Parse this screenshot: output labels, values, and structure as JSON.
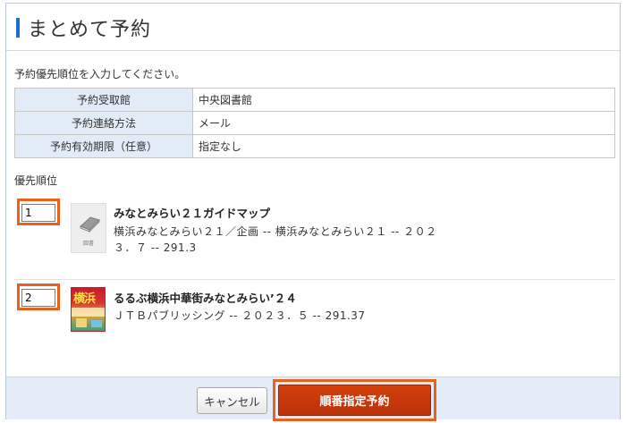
{
  "dialog": {
    "title": "まとめて予約"
  },
  "instruction": "予約優先順位を入力してください。",
  "settings": [
    {
      "label": "予約受取館",
      "value": "中央図書館"
    },
    {
      "label": "予約連絡方法",
      "value": "メール"
    },
    {
      "label": "予約有効期限（任意）",
      "value": "指定なし"
    }
  ],
  "priority_label": "優先順位",
  "items": [
    {
      "order": "1",
      "title": "みなとみらい２１ガイドマップ",
      "description": "横浜みなとみらい２１／企画 -- 横浜みなとみらい２１ -- ２０２\n３．７ -- 291.3",
      "thumbnail_label": "図書",
      "thumbnail_icon": "book-icon"
    },
    {
      "order": "2",
      "title": "るるぶ横浜中華街みなとみらい’２４",
      "description": "ＪＴＢパブリッシング -- ２０２３．５ -- 291.37",
      "cover_text": "横浜"
    }
  ],
  "buttons": {
    "cancel": "キャンセル",
    "submit": "順番指定予約"
  },
  "colors": {
    "accent_blue": "#1f6fd0",
    "highlight_orange": "#e8621c",
    "primary_button": "#c4390b",
    "table_label_bg": "#e1ecf8",
    "footer_bg": "#e4edf7"
  }
}
